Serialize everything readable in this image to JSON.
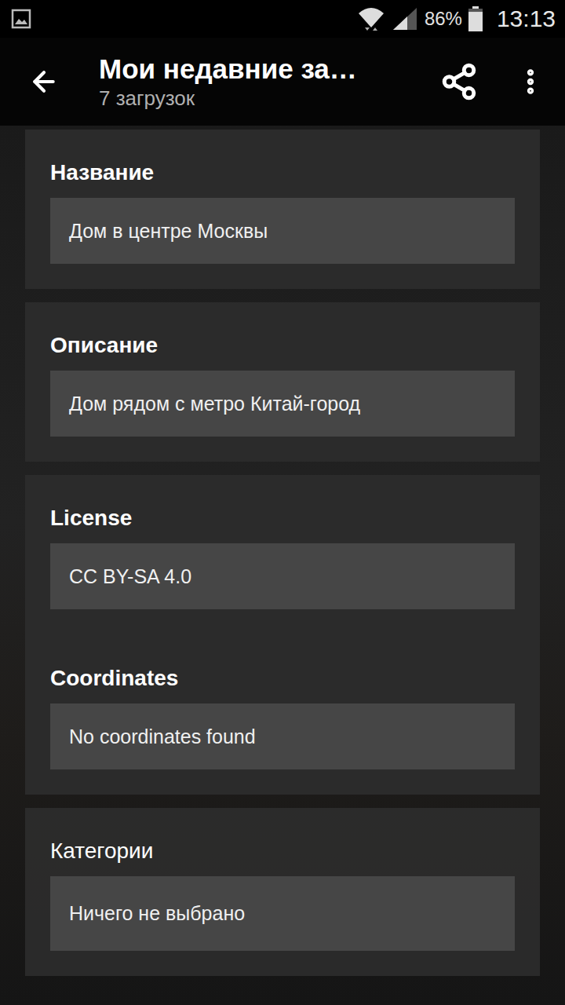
{
  "status_bar": {
    "battery": "86%",
    "time": "13:13",
    "battery_level": 0.86
  },
  "toolbar": {
    "title": "Мои недавние за…",
    "subtitle": "7 загрузок"
  },
  "sections": [
    {
      "fields": [
        {
          "label": "Название",
          "value": "Дом в центре Москвы",
          "kind": "text"
        }
      ]
    },
    {
      "fields": [
        {
          "label": "Описание",
          "value": "Дом рядом с метро Китай-город",
          "kind": "text"
        }
      ]
    },
    {
      "fields": [
        {
          "label": "License",
          "value": "CC BY-SA 4.0",
          "kind": "text"
        },
        {
          "label": "Coordinates",
          "value": "No coordinates found",
          "kind": "text"
        }
      ]
    },
    {
      "fields": [
        {
          "label": "Категории",
          "value": "Ничего не выбрано",
          "kind": "picker"
        }
      ]
    }
  ]
}
